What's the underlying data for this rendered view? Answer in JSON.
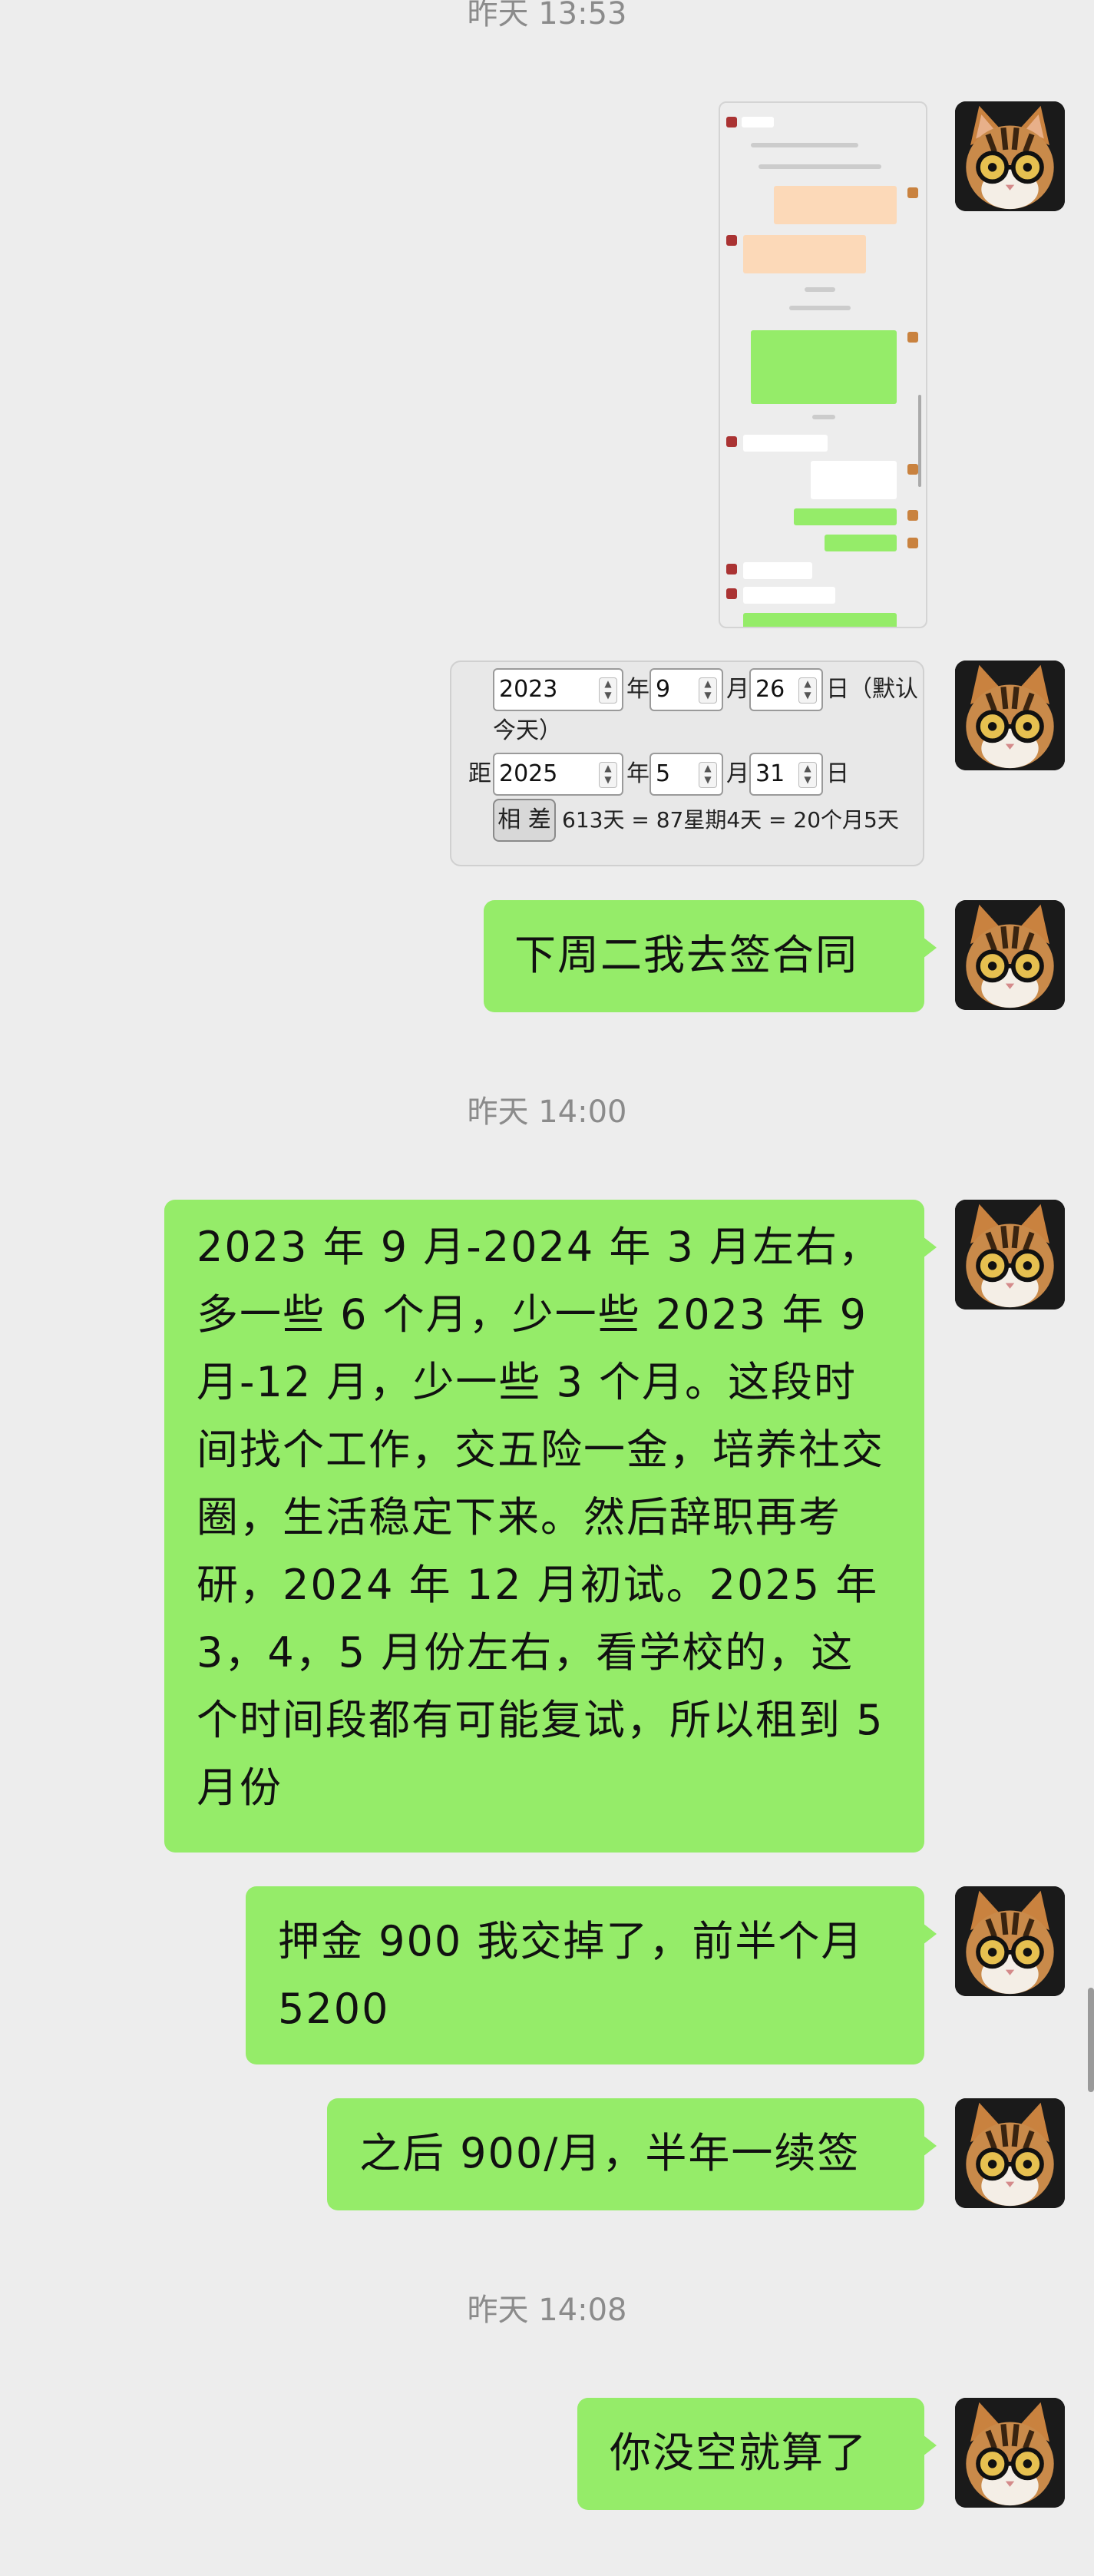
{
  "timestamps": [
    "昨天 13:53",
    "昨天 14:00",
    "昨天 14:08"
  ],
  "date_calc": {
    "start_year": "2023",
    "start_month": "9",
    "start_day": "26",
    "end_year": "2025",
    "end_month": "5",
    "end_day": "31",
    "label_year": "年",
    "label_month": "月",
    "label_day": "日",
    "default_note_a": "（默认",
    "default_note_b": "今天）",
    "to_label": "距",
    "diff_button": "相 差",
    "result": "613天 = 87星期4天 = 20个月5天"
  },
  "messages": [
    "下周二我去签合同",
    "2023 年 9 月-2024 年 3 月左右，多一些 6 个月，少一些 2023 年 9 月-12 月，少一些 3 个月。这段时间找个工作，交五险一金，培养社交圈，生活稳定下来。然后辞职再考研，2024 年 12 月初试。2025 年 3，4，5 月份左右，看学校的，这个时间段都有可能复试，所以租到 5 月份",
    "押金 900 我交掉了，前半个月 5200",
    "之后 900/月，半年一续签",
    "你没空就算了"
  ],
  "colors": {
    "bubble_green": "#95ec69",
    "background": "#ededed",
    "timestamp_gray": "#8b8b8b"
  }
}
